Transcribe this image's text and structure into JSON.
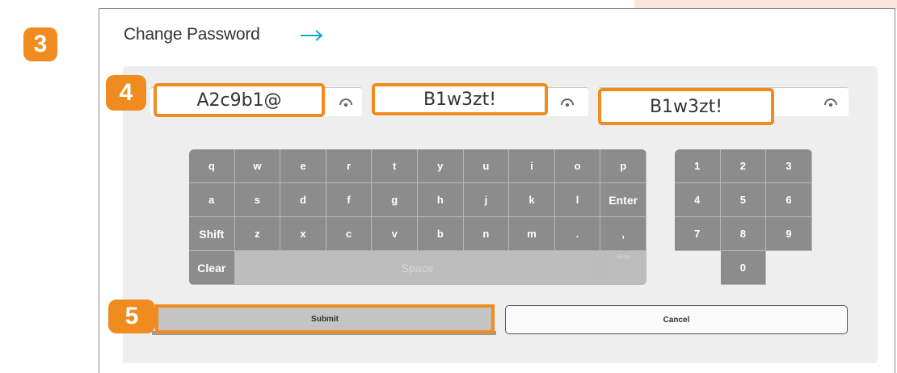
{
  "badges": {
    "step3": "3",
    "step4": "4",
    "step5": "5"
  },
  "header": {
    "title": "Change Password",
    "arrow_icon": "arrow-right-icon"
  },
  "fields": {
    "current_password": "A2c9b1@",
    "new_password": "B1w3zt!",
    "confirm_password": "B1w3zt!",
    "eye_icon": "eye-icon"
  },
  "keyboard": {
    "row1": [
      "q",
      "w",
      "e",
      "r",
      "t",
      "y",
      "u",
      "i",
      "o",
      "p"
    ],
    "row2": [
      "a",
      "s",
      "d",
      "f",
      "g",
      "h",
      "j",
      "k",
      "l",
      "Enter"
    ],
    "row3": [
      "Shift",
      "z",
      "x",
      "c",
      "v",
      "b",
      "n",
      "m",
      ".",
      ","
    ],
    "clear": "Clear",
    "space": "Space",
    "bksp": "Bksp"
  },
  "numpad": {
    "keys": [
      "1",
      "2",
      "3",
      "4",
      "5",
      "6",
      "7",
      "8",
      "9",
      "0"
    ]
  },
  "actions": {
    "submit": "Submit",
    "cancel": "Cancel"
  },
  "colors": {
    "accent": "#f08c1f",
    "arrow": "#1aa3d9",
    "key": "#8c8c8c"
  }
}
